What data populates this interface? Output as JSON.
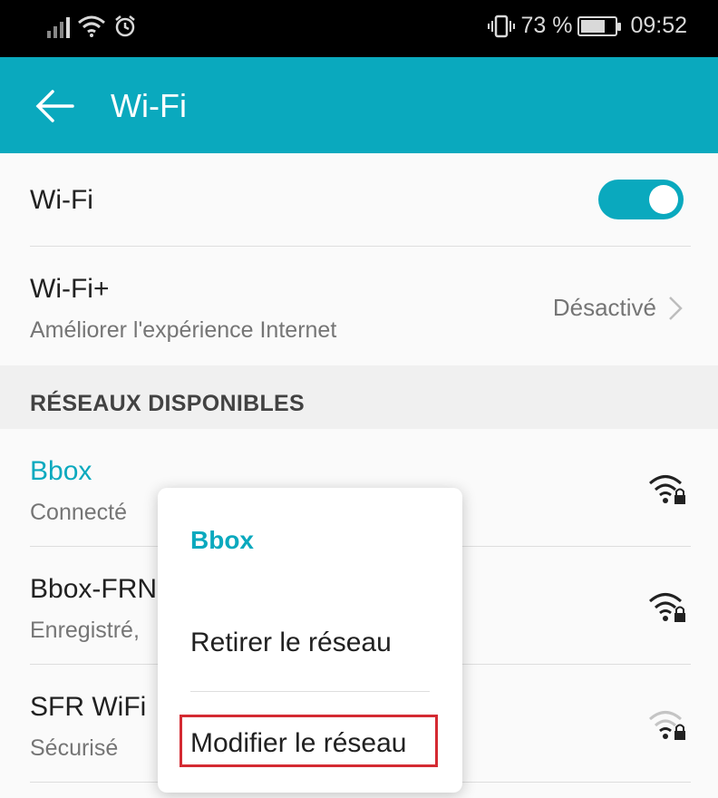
{
  "status_bar": {
    "battery_percent": "73 %",
    "time": "09:52",
    "battery_level": 0.73,
    "icons": [
      "signal-icon",
      "wifi-status-icon",
      "alarm-icon",
      "vibrate-icon",
      "battery-icon"
    ]
  },
  "app_bar": {
    "title": "Wi-Fi",
    "back_icon": "arrow-left-icon"
  },
  "wifi_toggle": {
    "label": "Wi-Fi",
    "enabled": true
  },
  "wifi_plus": {
    "label": "Wi-Fi+",
    "subtitle": "Améliorer l'expérience Internet",
    "value": "Désactivé"
  },
  "section": {
    "label": "RÉSEAUX DISPONIBLES"
  },
  "networks": [
    {
      "name": "Bbox",
      "status": "Connecté",
      "signal": "strong",
      "secured": true
    },
    {
      "name": "Bbox-FRN",
      "status": "Enregistré,",
      "signal": "strong",
      "secured": true
    },
    {
      "name": "SFR WiFi",
      "status": "Sécurisé",
      "signal": "weak",
      "secured": true
    }
  ],
  "context_menu": {
    "title": "Bbox",
    "items": [
      "Retirer le réseau",
      "Modifier le réseau"
    ],
    "highlighted_item": "Modifier le réseau"
  },
  "colors": {
    "accent": "#0aa9be",
    "highlight_border": "#d42a32",
    "status_bar": "#000000"
  }
}
